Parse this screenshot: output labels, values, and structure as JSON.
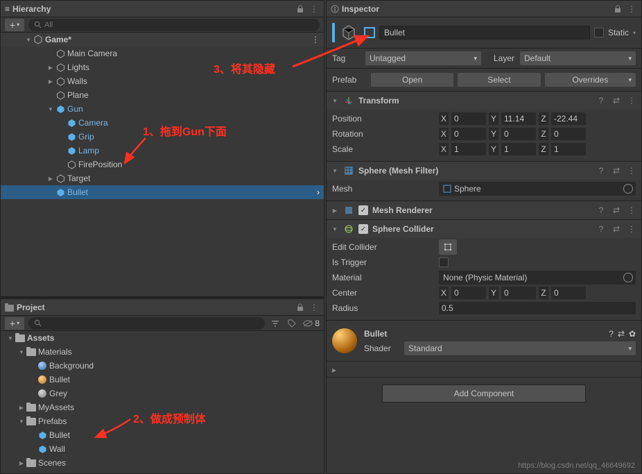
{
  "panels": {
    "hierarchy": {
      "title": "Hierarchy",
      "search_ph": "All"
    },
    "project": {
      "title": "Project",
      "hidden_count": "8"
    },
    "inspector": {
      "title": "Inspector"
    }
  },
  "hierarchy": {
    "scene": "Game*",
    "items": [
      {
        "label": "Main Camera",
        "indent": 2,
        "type": "go"
      },
      {
        "label": "Lights",
        "indent": 2,
        "type": "go",
        "fold": true
      },
      {
        "label": "Walls",
        "indent": 2,
        "type": "go",
        "fold": true
      },
      {
        "label": "Plane",
        "indent": 2,
        "type": "go"
      },
      {
        "label": "Gun",
        "indent": 2,
        "type": "prefab",
        "fold": true,
        "open": true
      },
      {
        "label": "Camera",
        "indent": 3,
        "type": "prefab-child"
      },
      {
        "label": "Grip",
        "indent": 3,
        "type": "prefab-child"
      },
      {
        "label": "Lamp",
        "indent": 3,
        "type": "prefab-child"
      },
      {
        "label": "FirePosition",
        "indent": 3,
        "type": "go"
      },
      {
        "label": "Target",
        "indent": 2,
        "type": "go",
        "fold": true
      },
      {
        "label": "Bullet",
        "indent": 2,
        "type": "prefab",
        "selected": true
      }
    ]
  },
  "project": {
    "root": "Assets",
    "items": [
      {
        "label": "Materials",
        "indent": 1,
        "type": "folder",
        "open": true
      },
      {
        "label": "Background",
        "indent": 2,
        "type": "mat-blue"
      },
      {
        "label": "Bullet",
        "indent": 2,
        "type": "mat-orange"
      },
      {
        "label": "Grey",
        "indent": 2,
        "type": "mat-grey"
      },
      {
        "label": "MyAssets",
        "indent": 1,
        "type": "folder"
      },
      {
        "label": "Prefabs",
        "indent": 1,
        "type": "folder",
        "open": true
      },
      {
        "label": "Bullet",
        "indent": 2,
        "type": "prefab"
      },
      {
        "label": "Wall",
        "indent": 2,
        "type": "prefab"
      },
      {
        "label": "Scenes",
        "indent": 1,
        "type": "folder"
      }
    ]
  },
  "inspector": {
    "name": "Bullet",
    "static_label": "Static",
    "tag_label": "Tag",
    "tag_value": "Untagged",
    "layer_label": "Layer",
    "layer_value": "Default",
    "prefab_label": "Prefab",
    "open_btn": "Open",
    "select_btn": "Select",
    "overrides_btn": "Overrides",
    "transform": {
      "title": "Transform",
      "position_label": "Position",
      "pos": {
        "x": "0",
        "y": "11.14",
        "z": "-22.44"
      },
      "rotation_label": "Rotation",
      "rot": {
        "x": "0",
        "y": "0",
        "z": "0"
      },
      "scale_label": "Scale",
      "scl": {
        "x": "1",
        "y": "1",
        "z": "1"
      }
    },
    "meshfilter": {
      "title": "Sphere (Mesh Filter)",
      "mesh_label": "Mesh",
      "mesh_value": "Sphere"
    },
    "meshrenderer": {
      "title": "Mesh Renderer"
    },
    "collider": {
      "title": "Sphere Collider",
      "edit_label": "Edit Collider",
      "trigger_label": "Is Trigger",
      "material_label": "Material",
      "material_value": "None (Physic Material)",
      "center_label": "Center",
      "center": {
        "x": "0",
        "y": "0",
        "z": "0"
      },
      "radius_label": "Radius",
      "radius": "0.5"
    },
    "material": {
      "name": "Bullet",
      "shader_label": "Shader",
      "shader_value": "Standard"
    },
    "add_component": "Add Component"
  },
  "annotations": {
    "a1": "1、拖到Gun下面",
    "a2": "2、做成预制体",
    "a3": "3、将其隐藏"
  },
  "watermark": "https://blog.csdn.net/qq_46649692"
}
